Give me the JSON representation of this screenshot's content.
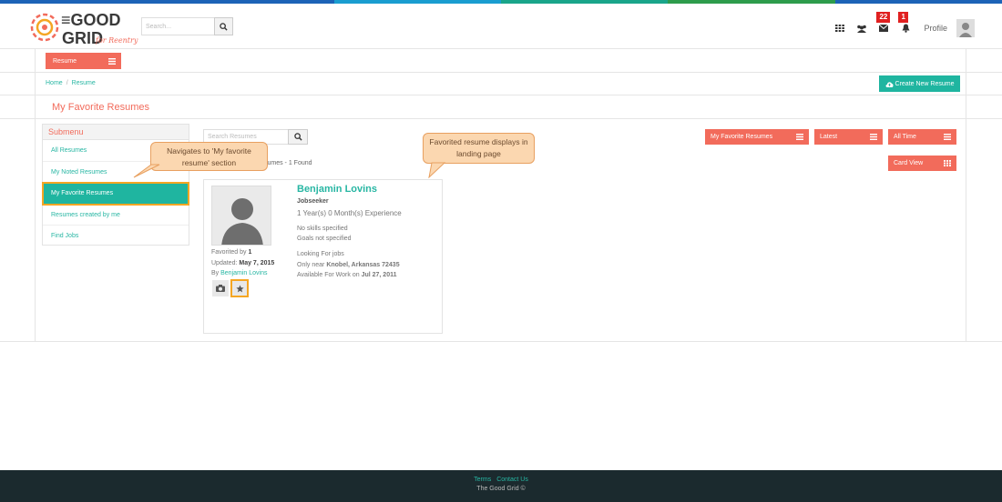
{
  "colors": {
    "accent": "#f26b5b",
    "teal": "#1fb5a0",
    "highlight": "#f5a623",
    "footer": "#1b2a2e"
  },
  "header": {
    "logo_alt": "THE GOOD GRID for Reentry",
    "search_placeholder": "Search...",
    "messages_count": "22",
    "notifications_count": "1",
    "profile_label": "Profile"
  },
  "menu": {
    "resume_label": "Resume"
  },
  "breadcrumb": {
    "home": "Home",
    "current": "Resume"
  },
  "create_button": "Create New Resume",
  "page_title": "My Favorite Resumes",
  "submenu": {
    "title": "Submenu",
    "items": [
      "All Resumes",
      "My Noted Resumes",
      "My Favorite Resumes",
      "Resumes created by me",
      "Find Jobs"
    ]
  },
  "callouts": {
    "left": "Navigates to 'My favorite resume' section",
    "right": "Favorited resume displays in landing page"
  },
  "filters": {
    "search_placeholder": "Search Resumes",
    "favorites": "My Favorite Resumes",
    "latest": "Latest",
    "all_time": "All Time",
    "card_view": "Card View"
  },
  "results_text": "sumes - 1 Found",
  "card": {
    "name": "Benjamin Lovins",
    "role": "Jobseeker",
    "experience": "1 Year(s) 0 Month(s) Experience",
    "skills": "No skills specified",
    "goals": "Goals not specified",
    "looking": "Looking For jobs",
    "near_prefix": "Only near",
    "near_value": "Knobel, Arkansas 72435",
    "avail_prefix": "Available For Work on",
    "avail_value": "Jul 27, 2011",
    "favorited_prefix": "Favorited by",
    "favorited_count": "1",
    "updated_prefix": "Updated:",
    "updated_value": "May 7, 2015",
    "by_prefix": "By",
    "by_name": "Benjamin Lovins"
  },
  "footer": {
    "terms": "Terms",
    "contact": "Contact Us",
    "copyright": "The Good Grid ©"
  }
}
